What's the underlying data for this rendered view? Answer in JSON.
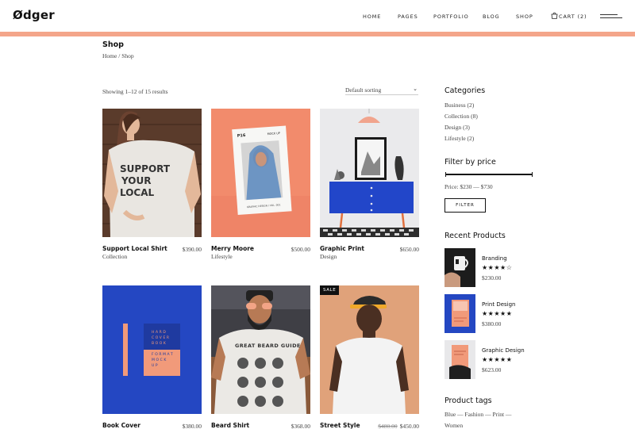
{
  "header": {
    "logo": "Ødger",
    "nav": [
      {
        "label": "HOME"
      },
      {
        "label": "PAGES"
      },
      {
        "label": "PORTFOLIO"
      },
      {
        "label": "BLOG"
      },
      {
        "label": "SHOP"
      }
    ],
    "cart_label": "CART",
    "cart_count": "(2)"
  },
  "page": {
    "title": "Shop",
    "breadcrumb_home": "Home",
    "breadcrumb_sep": " / ",
    "breadcrumb_current": "Shop"
  },
  "toolbar": {
    "results": "Showing 1–12 of 15 results",
    "sort_value": "Default sorting"
  },
  "products": [
    {
      "name": "Support Local Shirt",
      "category": "Collection",
      "price": "$390.00"
    },
    {
      "name": "Merry Moore",
      "category": "Lifestyle",
      "price": "$500.00"
    },
    {
      "name": "Graphic Print",
      "category": "Design",
      "price": "$650.00"
    },
    {
      "name": "Book Cover",
      "category": "",
      "price": "$380.00"
    },
    {
      "name": "Beard Shirt",
      "category": "",
      "price": "$368.00"
    },
    {
      "name": "Street Style",
      "category": "",
      "old_price": "$480.00",
      "price": "$450.00",
      "badge": "SALE"
    }
  ],
  "image_text": {
    "shirt_print": "SUPPORT YOUR LOCAL",
    "mag_title": "P16",
    "mag_sub": "MOCK UP",
    "mag_footer": "GRAPHIC DESIGN / VOL. 001",
    "book_cover": "HARD COVER BOOK A4 FORMAT MOCK UP",
    "shirt2_print": "GREAT BEARD GUIDE"
  },
  "sidebar": {
    "categories_title": "Categories",
    "categories": [
      {
        "label": "Business (2)"
      },
      {
        "label": "Collection (8)"
      },
      {
        "label": "Design (3)"
      },
      {
        "label": "Lifestyle (2)"
      }
    ],
    "filter_title": "Filter by price",
    "price_range": "Price: $230 — $730",
    "filter_button": "FILTER",
    "recent_title": "Recent Products",
    "recent": [
      {
        "name": "Branding",
        "rating": 4,
        "price": "$230.00",
        "stars": "★★★★☆"
      },
      {
        "name": "Print Design",
        "rating": 5,
        "price": "$380.00",
        "stars": "★★★★★"
      },
      {
        "name": "Graphic Design",
        "rating": 5,
        "price": "$623.00",
        "stars": "★★★★★"
      }
    ],
    "tags_title": "Product tags",
    "tags": [
      "Blue",
      "Fashion",
      "Print",
      "Women"
    ],
    "tag_sep": " — "
  },
  "colors": {
    "accent_salmon": "#f4a58a",
    "accent_blue": "#2643b8",
    "text_dark": "#111111",
    "text_muted": "#444444"
  }
}
